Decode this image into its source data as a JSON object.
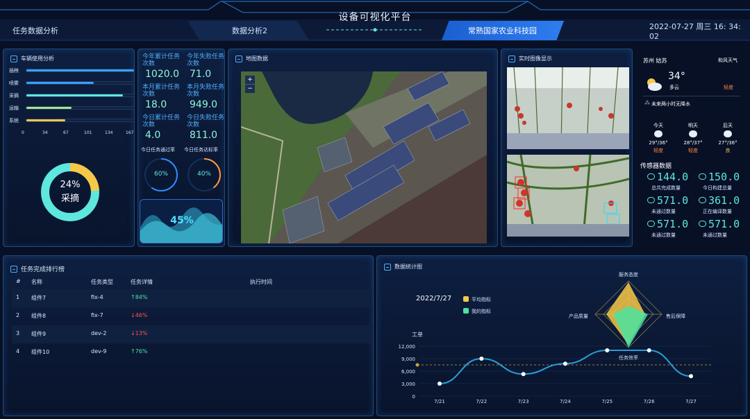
{
  "header": {
    "title": "设备可视化平台",
    "tabs": [
      "任务数据分析",
      "数据分析2",
      "常熟国家农业科技园"
    ],
    "datetime": "2022-07-27 周三 16: 34: 02"
  },
  "vehicle_panel": {
    "title": "车辆使用分析",
    "bars": [
      {
        "label": "插秧",
        "value": 167,
        "color": "#3aa0ff"
      },
      {
        "label": "喷雾",
        "value": 105,
        "color": "#3aa0ff"
      },
      {
        "label": "采摘",
        "value": 150,
        "color": "#5ee7df"
      },
      {
        "label": "运输",
        "value": 70,
        "color": "#a9e58a"
      },
      {
        "label": "系统",
        "value": 60,
        "color": "#f7c847"
      }
    ],
    "axis_ticks": [
      "0",
      "34",
      "67",
      "101",
      "134",
      "167"
    ],
    "donut_percent": "24%",
    "donut_label": "采摘",
    "donut_fraction": 0.24
  },
  "task_stats": {
    "items": [
      {
        "label": "今年累计任务次数",
        "value": "1020.0"
      },
      {
        "label": "今年失败任务次数",
        "value": "71.0"
      },
      {
        "label": "本月累计任务次数",
        "value": "18.0"
      },
      {
        "label": "本月失败任务次数",
        "value": "949.0"
      },
      {
        "label": "今日累计任务次数",
        "value": "4.0"
      },
      {
        "label": "今日失败任务次数",
        "value": "811.0"
      }
    ],
    "pass_rate_label": "今日任务通过率",
    "reach_rate_label": "今日任务达标率",
    "pass_rate": "60%",
    "reach_rate": "40%",
    "pass_fraction": 0.6,
    "reach_fraction": 0.4,
    "wave_percent": "45%"
  },
  "map_panel": {
    "title": "地图数据",
    "zoom_in": "+",
    "zoom_out": "−"
  },
  "image_panel": {
    "title": "实时图像显示"
  },
  "weather": {
    "city": "苏州 姑苏",
    "wind": "和风天气",
    "temp": "34°",
    "condition": "多云",
    "aqi": "轻度",
    "rain_note": "未来两小时无降水",
    "forecast": [
      {
        "day": "今天",
        "range": "29°/36°",
        "aqi": "轻度"
      },
      {
        "day": "明天",
        "range": "28°/37°",
        "aqi": "轻度"
      },
      {
        "day": "后天",
        "range": "27°/36°",
        "aqi": "良"
      }
    ],
    "colors": {
      "aqi_mild": "#ff8a3d",
      "aqi_good": "#f7c847"
    }
  },
  "sensor": {
    "title": "传感器数据",
    "items": [
      {
        "value": "144.0",
        "label": "总共完成数量",
        "icon": "chart-icon"
      },
      {
        "value": "150.0",
        "label": "今日构建总量",
        "icon": "heart-icon"
      },
      {
        "value": "571.0",
        "label": "未通过数量",
        "icon": "cloud-icon"
      },
      {
        "value": "361.0",
        "label": "正在编译数量",
        "icon": "cloud-icon"
      },
      {
        "value": "571.0",
        "label": "未通过数量",
        "icon": "cloud-icon"
      },
      {
        "value": "571.0",
        "label": "未通过数量",
        "icon": "cloud-icon"
      }
    ]
  },
  "ranking": {
    "title": "任务完成排行榜",
    "columns": [
      "#",
      "名称",
      "任务类型",
      "任务详情",
      "执行时间"
    ],
    "rows": [
      {
        "idx": "1",
        "name": "组件7",
        "type": "fix-4",
        "detail": "↑84%",
        "dir": "up",
        "time": ""
      },
      {
        "idx": "2",
        "name": "组件8",
        "type": "fix-7",
        "detail": "↓46%",
        "dir": "down",
        "time": ""
      },
      {
        "idx": "3",
        "name": "组件9",
        "type": "dev-2",
        "detail": "↓13%",
        "dir": "down",
        "time": ""
      },
      {
        "idx": "4",
        "name": "组件10",
        "type": "dev-9",
        "detail": "↑76%",
        "dir": "up",
        "time": ""
      }
    ]
  },
  "stats_panel": {
    "title": "数据统计图",
    "date": "2022/7/27",
    "legend": [
      {
        "label": "平均指标",
        "color": "#f7c847"
      },
      {
        "label": "我的指标",
        "color": "#4be3a1"
      }
    ],
    "radar_labels": [
      "服务态度",
      "售后保障",
      "任务效率",
      "产品质量"
    ]
  },
  "chart_data": {
    "type": "line",
    "ylabel": "工单",
    "categories": [
      "7/21",
      "7/22",
      "7/23",
      "7/24",
      "7/25",
      "7/26",
      "7/27"
    ],
    "yticks": [
      "12,000",
      "9,000",
      "6,000",
      "3,000",
      "0"
    ],
    "ylim": [
      0,
      12000
    ],
    "series": [
      {
        "values": [
          3000,
          9000,
          5300,
          7800,
          11000,
          11000,
          4800
        ]
      }
    ],
    "average_line": 7500
  }
}
